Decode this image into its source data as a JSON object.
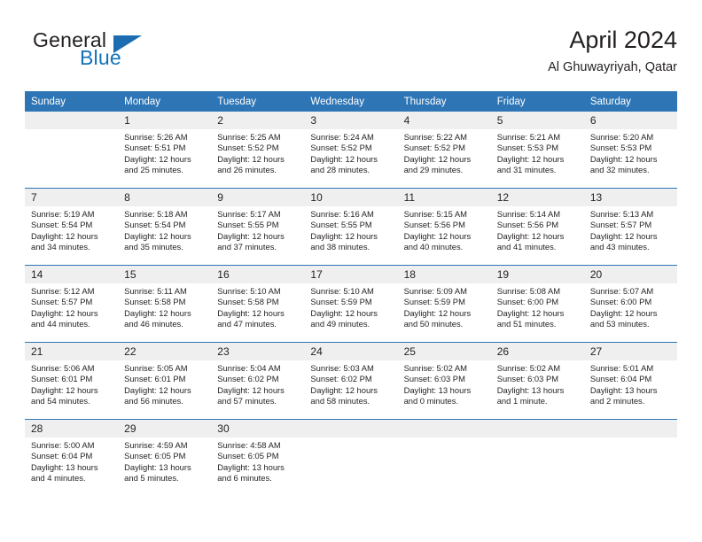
{
  "brand": {
    "name_part1": "General",
    "name_part2": "Blue",
    "logo_icon": "triangle-logo-icon",
    "color_primary": "#1272ba",
    "color_triangle": "#1b6cb0"
  },
  "header": {
    "title": "April 2024",
    "subtitle": "Al Ghuwayriyah, Qatar"
  },
  "theme": {
    "header_bg": "#2e75b6",
    "header_text": "#ffffff",
    "daynum_bg": "#efefef",
    "separator": "#2e75b6",
    "text": "#231f20"
  },
  "calendar": {
    "weekday_headers": [
      "Sunday",
      "Monday",
      "Tuesday",
      "Wednesday",
      "Thursday",
      "Friday",
      "Saturday"
    ],
    "weeks": [
      {
        "days": [
          {
            "num": "",
            "sunrise": "",
            "sunset": "",
            "daylight_1": "",
            "daylight_2": "",
            "empty": true
          },
          {
            "num": "1",
            "sunrise": "Sunrise: 5:26 AM",
            "sunset": "Sunset: 5:51 PM",
            "daylight_1": "Daylight: 12 hours",
            "daylight_2": "and 25 minutes.",
            "empty": false
          },
          {
            "num": "2",
            "sunrise": "Sunrise: 5:25 AM",
            "sunset": "Sunset: 5:52 PM",
            "daylight_1": "Daylight: 12 hours",
            "daylight_2": "and 26 minutes.",
            "empty": false
          },
          {
            "num": "3",
            "sunrise": "Sunrise: 5:24 AM",
            "sunset": "Sunset: 5:52 PM",
            "daylight_1": "Daylight: 12 hours",
            "daylight_2": "and 28 minutes.",
            "empty": false
          },
          {
            "num": "4",
            "sunrise": "Sunrise: 5:22 AM",
            "sunset": "Sunset: 5:52 PM",
            "daylight_1": "Daylight: 12 hours",
            "daylight_2": "and 29 minutes.",
            "empty": false
          },
          {
            "num": "5",
            "sunrise": "Sunrise: 5:21 AM",
            "sunset": "Sunset: 5:53 PM",
            "daylight_1": "Daylight: 12 hours",
            "daylight_2": "and 31 minutes.",
            "empty": false
          },
          {
            "num": "6",
            "sunrise": "Sunrise: 5:20 AM",
            "sunset": "Sunset: 5:53 PM",
            "daylight_1": "Daylight: 12 hours",
            "daylight_2": "and 32 minutes.",
            "empty": false
          }
        ]
      },
      {
        "days": [
          {
            "num": "7",
            "sunrise": "Sunrise: 5:19 AM",
            "sunset": "Sunset: 5:54 PM",
            "daylight_1": "Daylight: 12 hours",
            "daylight_2": "and 34 minutes.",
            "empty": false
          },
          {
            "num": "8",
            "sunrise": "Sunrise: 5:18 AM",
            "sunset": "Sunset: 5:54 PM",
            "daylight_1": "Daylight: 12 hours",
            "daylight_2": "and 35 minutes.",
            "empty": false
          },
          {
            "num": "9",
            "sunrise": "Sunrise: 5:17 AM",
            "sunset": "Sunset: 5:55 PM",
            "daylight_1": "Daylight: 12 hours",
            "daylight_2": "and 37 minutes.",
            "empty": false
          },
          {
            "num": "10",
            "sunrise": "Sunrise: 5:16 AM",
            "sunset": "Sunset: 5:55 PM",
            "daylight_1": "Daylight: 12 hours",
            "daylight_2": "and 38 minutes.",
            "empty": false
          },
          {
            "num": "11",
            "sunrise": "Sunrise: 5:15 AM",
            "sunset": "Sunset: 5:56 PM",
            "daylight_1": "Daylight: 12 hours",
            "daylight_2": "and 40 minutes.",
            "empty": false
          },
          {
            "num": "12",
            "sunrise": "Sunrise: 5:14 AM",
            "sunset": "Sunset: 5:56 PM",
            "daylight_1": "Daylight: 12 hours",
            "daylight_2": "and 41 minutes.",
            "empty": false
          },
          {
            "num": "13",
            "sunrise": "Sunrise: 5:13 AM",
            "sunset": "Sunset: 5:57 PM",
            "daylight_1": "Daylight: 12 hours",
            "daylight_2": "and 43 minutes.",
            "empty": false
          }
        ]
      },
      {
        "days": [
          {
            "num": "14",
            "sunrise": "Sunrise: 5:12 AM",
            "sunset": "Sunset: 5:57 PM",
            "daylight_1": "Daylight: 12 hours",
            "daylight_2": "and 44 minutes.",
            "empty": false
          },
          {
            "num": "15",
            "sunrise": "Sunrise: 5:11 AM",
            "sunset": "Sunset: 5:58 PM",
            "daylight_1": "Daylight: 12 hours",
            "daylight_2": "and 46 minutes.",
            "empty": false
          },
          {
            "num": "16",
            "sunrise": "Sunrise: 5:10 AM",
            "sunset": "Sunset: 5:58 PM",
            "daylight_1": "Daylight: 12 hours",
            "daylight_2": "and 47 minutes.",
            "empty": false
          },
          {
            "num": "17",
            "sunrise": "Sunrise: 5:10 AM",
            "sunset": "Sunset: 5:59 PM",
            "daylight_1": "Daylight: 12 hours",
            "daylight_2": "and 49 minutes.",
            "empty": false
          },
          {
            "num": "18",
            "sunrise": "Sunrise: 5:09 AM",
            "sunset": "Sunset: 5:59 PM",
            "daylight_1": "Daylight: 12 hours",
            "daylight_2": "and 50 minutes.",
            "empty": false
          },
          {
            "num": "19",
            "sunrise": "Sunrise: 5:08 AM",
            "sunset": "Sunset: 6:00 PM",
            "daylight_1": "Daylight: 12 hours",
            "daylight_2": "and 51 minutes.",
            "empty": false
          },
          {
            "num": "20",
            "sunrise": "Sunrise: 5:07 AM",
            "sunset": "Sunset: 6:00 PM",
            "daylight_1": "Daylight: 12 hours",
            "daylight_2": "and 53 minutes.",
            "empty": false
          }
        ]
      },
      {
        "days": [
          {
            "num": "21",
            "sunrise": "Sunrise: 5:06 AM",
            "sunset": "Sunset: 6:01 PM",
            "daylight_1": "Daylight: 12 hours",
            "daylight_2": "and 54 minutes.",
            "empty": false
          },
          {
            "num": "22",
            "sunrise": "Sunrise: 5:05 AM",
            "sunset": "Sunset: 6:01 PM",
            "daylight_1": "Daylight: 12 hours",
            "daylight_2": "and 56 minutes.",
            "empty": false
          },
          {
            "num": "23",
            "sunrise": "Sunrise: 5:04 AM",
            "sunset": "Sunset: 6:02 PM",
            "daylight_1": "Daylight: 12 hours",
            "daylight_2": "and 57 minutes.",
            "empty": false
          },
          {
            "num": "24",
            "sunrise": "Sunrise: 5:03 AM",
            "sunset": "Sunset: 6:02 PM",
            "daylight_1": "Daylight: 12 hours",
            "daylight_2": "and 58 minutes.",
            "empty": false
          },
          {
            "num": "25",
            "sunrise": "Sunrise: 5:02 AM",
            "sunset": "Sunset: 6:03 PM",
            "daylight_1": "Daylight: 13 hours",
            "daylight_2": "and 0 minutes.",
            "empty": false
          },
          {
            "num": "26",
            "sunrise": "Sunrise: 5:02 AM",
            "sunset": "Sunset: 6:03 PM",
            "daylight_1": "Daylight: 13 hours",
            "daylight_2": "and 1 minute.",
            "empty": false
          },
          {
            "num": "27",
            "sunrise": "Sunrise: 5:01 AM",
            "sunset": "Sunset: 6:04 PM",
            "daylight_1": "Daylight: 13 hours",
            "daylight_2": "and 2 minutes.",
            "empty": false
          }
        ]
      },
      {
        "days": [
          {
            "num": "28",
            "sunrise": "Sunrise: 5:00 AM",
            "sunset": "Sunset: 6:04 PM",
            "daylight_1": "Daylight: 13 hours",
            "daylight_2": "and 4 minutes.",
            "empty": false
          },
          {
            "num": "29",
            "sunrise": "Sunrise: 4:59 AM",
            "sunset": "Sunset: 6:05 PM",
            "daylight_1": "Daylight: 13 hours",
            "daylight_2": "and 5 minutes.",
            "empty": false
          },
          {
            "num": "30",
            "sunrise": "Sunrise: 4:58 AM",
            "sunset": "Sunset: 6:05 PM",
            "daylight_1": "Daylight: 13 hours",
            "daylight_2": "and 6 minutes.",
            "empty": false
          },
          {
            "num": "",
            "sunrise": "",
            "sunset": "",
            "daylight_1": "",
            "daylight_2": "",
            "empty": true
          },
          {
            "num": "",
            "sunrise": "",
            "sunset": "",
            "daylight_1": "",
            "daylight_2": "",
            "empty": true
          },
          {
            "num": "",
            "sunrise": "",
            "sunset": "",
            "daylight_1": "",
            "daylight_2": "",
            "empty": true
          },
          {
            "num": "",
            "sunrise": "",
            "sunset": "",
            "daylight_1": "",
            "daylight_2": "",
            "empty": true
          }
        ]
      }
    ]
  }
}
